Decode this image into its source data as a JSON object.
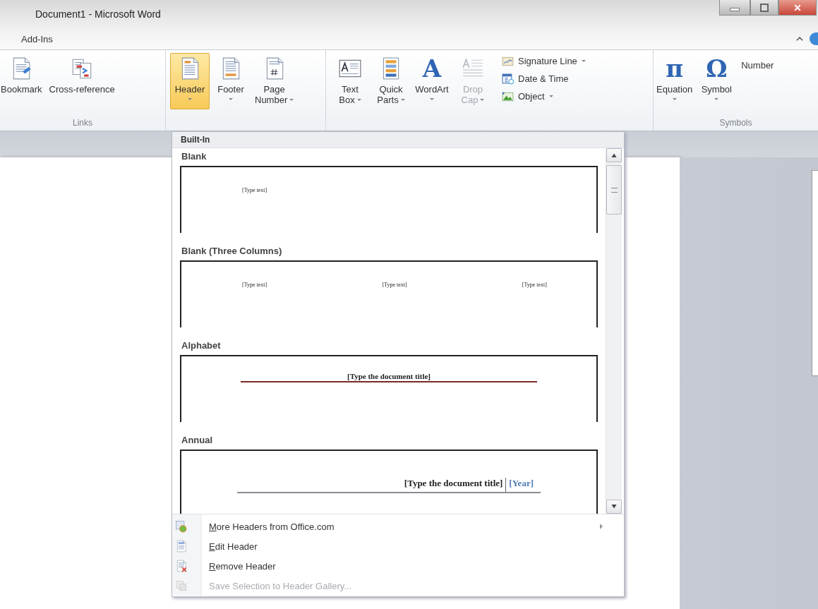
{
  "window": {
    "title": "Document1  -  Microsoft Word"
  },
  "ribbon_tab": "Add-Ins",
  "ribbon": {
    "groups": [
      {
        "label": "Links",
        "buttons": [
          {
            "kind": "large",
            "lines": [
              "Bookmark"
            ],
            "dropdown": false,
            "selected": false,
            "disabled": false
          },
          {
            "kind": "large",
            "lines": [
              "Cross-reference"
            ],
            "dropdown": false,
            "selected": false,
            "disabled": false
          }
        ]
      },
      {
        "buttons": [
          {
            "kind": "large",
            "lines": [
              "Header"
            ],
            "dropdown": true,
            "selected": true,
            "disabled": false
          },
          {
            "kind": "large",
            "lines": [
              "Footer"
            ],
            "dropdown": true,
            "selected": false,
            "disabled": false
          },
          {
            "kind": "large",
            "lines": [
              "Page",
              "Number"
            ],
            "dropdown": true,
            "selected": false,
            "disabled": false
          }
        ]
      },
      {
        "buttons": [
          {
            "kind": "large",
            "lines": [
              "Text",
              "Box"
            ],
            "dropdown": true,
            "selected": false,
            "disabled": false
          },
          {
            "kind": "large",
            "lines": [
              "Quick",
              "Parts"
            ],
            "dropdown": true,
            "selected": false,
            "disabled": false
          },
          {
            "kind": "large",
            "lines": [
              "WordArt"
            ],
            "glyph": "A",
            "dropdown": true,
            "selected": false,
            "disabled": false
          },
          {
            "kind": "large",
            "lines": [
              "Drop",
              "Cap"
            ],
            "dropdown": true,
            "selected": false,
            "disabled": true
          },
          {
            "kind": "stack",
            "items": [
              {
                "label": "Signature Line",
                "dropdown": true
              },
              {
                "label": "Date & Time",
                "dropdown": false
              },
              {
                "label": "Object",
                "dropdown": true
              }
            ]
          }
        ]
      },
      {
        "label": "Symbols",
        "buttons": [
          {
            "kind": "large",
            "lines": [
              "Equation"
            ],
            "glyph": "π",
            "dropdown": true,
            "selected": false,
            "disabled": false
          },
          {
            "kind": "large",
            "lines": [
              "Symbol"
            ],
            "glyph": "Ω",
            "dropdown": true,
            "selected": false,
            "disabled": false
          },
          {
            "kind": "large",
            "lines": [
              "Number"
            ],
            "dropdown": false,
            "selected": false,
            "disabled": false
          }
        ]
      }
    ]
  },
  "header_menu": {
    "section_title": "Built-In",
    "gallery": [
      {
        "title": "Blank",
        "kind": "blank",
        "texts": [
          "[Type text]"
        ]
      },
      {
        "title": "Blank (Three Columns)",
        "kind": "three_columns",
        "texts": [
          "[Type text]",
          "[Type text]",
          "[Type text]"
        ]
      },
      {
        "title": "Alphabet",
        "kind": "alphabet",
        "texts": [
          "[Type the document title]"
        ]
      },
      {
        "title": "Annual",
        "kind": "annual",
        "texts": [
          "[Type the document title]",
          "[Year]"
        ]
      }
    ],
    "items": [
      {
        "label": "More Headers from Office.com",
        "underline_first": true,
        "submenu": true,
        "disabled": false
      },
      {
        "label": "Edit Header",
        "underline_first": true,
        "submenu": false,
        "disabled": false
      },
      {
        "label": "Remove Header",
        "underline_first": true,
        "submenu": false,
        "disabled": false
      },
      {
        "label": "Save Selection to Header Gallery...",
        "underline_first": false,
        "submenu": false,
        "disabled": true
      }
    ]
  }
}
